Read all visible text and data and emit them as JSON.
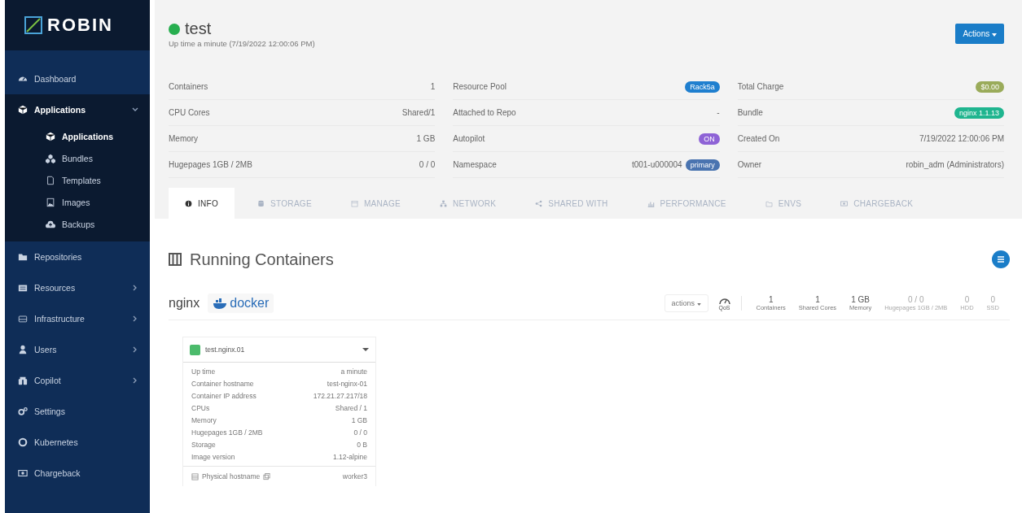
{
  "sidebar": {
    "logo": "ROBIN",
    "items": [
      {
        "label": "Dashboard",
        "selected": false
      },
      {
        "label": "Applications",
        "selected": true,
        "expanded": true,
        "children": [
          {
            "label": "Applications",
            "selected": true
          },
          {
            "label": "Bundles",
            "selected": false
          },
          {
            "label": "Templates",
            "selected": false
          },
          {
            "label": "Images",
            "selected": false
          },
          {
            "label": "Backups",
            "selected": false
          }
        ]
      },
      {
        "label": "Repositories",
        "selected": false
      },
      {
        "label": "Resources",
        "selected": false,
        "expanded": false
      },
      {
        "label": "Infrastructure",
        "selected": false,
        "expanded": false
      },
      {
        "label": "Users",
        "selected": false,
        "expanded": false
      },
      {
        "label": "Copilot",
        "selected": false,
        "expanded": false
      },
      {
        "label": "Settings",
        "selected": false
      },
      {
        "label": "Kubernetes",
        "selected": false
      },
      {
        "label": "Chargeback",
        "selected": false
      }
    ]
  },
  "header": {
    "title": "test",
    "running": true,
    "subtitle": "Up time a minute  (7/19/2022 12:00:06 PM)",
    "actions_button": "Actions"
  },
  "details": [
    {
      "label": "Containers",
      "value": "1",
      "kind": "text"
    },
    {
      "label": "Resource Pool",
      "value": "Rack5a",
      "kind": "badge",
      "color": "#1f7fcf"
    },
    {
      "label": "Total Charge",
      "value": "$0.00",
      "kind": "badge",
      "color": "#9aab5a"
    },
    {
      "label": "CPU Cores",
      "value": "Shared/1",
      "kind": "text"
    },
    {
      "label": "Attached to Repo",
      "value": "-",
      "kind": "text"
    },
    {
      "label": "Bundle",
      "value": "nginx 1.1.13",
      "kind": "badge",
      "color": "#1fb58f"
    },
    {
      "label": "Memory",
      "value": "1 GB",
      "kind": "text"
    },
    {
      "label": "Autopilot",
      "value": "ON",
      "kind": "badge",
      "color": "#8e63d6"
    },
    {
      "label": "Created On",
      "value": "7/19/2022 12:00:06 PM",
      "kind": "text"
    },
    {
      "label": "Hugepages 1GB / 2MB",
      "value": "0 / 0",
      "kind": "text"
    },
    {
      "label": "Namespace",
      "value": "t001-u000004",
      "kind": "text_badge",
      "badge": "primary",
      "color": "#4a74b0"
    },
    {
      "label": "Owner",
      "value": "robin_adm (Administrators)",
      "kind": "text"
    }
  ],
  "tabs": [
    {
      "label": "INFO",
      "selected": true
    },
    {
      "label": "STORAGE",
      "selected": false
    },
    {
      "label": "MANAGE",
      "selected": false
    },
    {
      "label": "NETWORK",
      "selected": false
    },
    {
      "label": "SHARED WITH",
      "selected": false
    },
    {
      "label": "PERFORMANCE",
      "selected": false
    },
    {
      "label": "ENVS",
      "selected": false
    },
    {
      "label": "CHARGEBACK",
      "selected": false
    }
  ],
  "running_containers": {
    "title": "Running Containers",
    "role": {
      "name": "nginx",
      "runtime_label": "docker",
      "actions_dropdown": "actions",
      "qos_label": "QoS",
      "stats": [
        {
          "value": "1",
          "label": "Containers",
          "disabled": false
        },
        {
          "value": "1",
          "label": "Shared Cores",
          "disabled": false
        },
        {
          "value": "1 GB",
          "label": "Memory",
          "disabled": false
        },
        {
          "value": "0 / 0",
          "label": "Hugepages 1GB / 2MB",
          "disabled": true
        },
        {
          "value": "0",
          "label": "HDD",
          "disabled": true
        },
        {
          "value": "0",
          "label": "SSD",
          "disabled": true
        }
      ]
    },
    "container": {
      "name": "test.nginx.01",
      "running": true,
      "expanded": true,
      "rows": [
        {
          "label": "Up time",
          "value": "a minute"
        },
        {
          "label": "Container hostname",
          "value": "test-nginx-01"
        },
        {
          "label": "Container IP address",
          "value": "172.21.27.217/18"
        },
        {
          "label": "CPUs",
          "value": "Shared / 1"
        },
        {
          "label": "Memory",
          "value": "1 GB"
        },
        {
          "label": "Hugepages 1GB / 2MB",
          "value": "0 / 0"
        },
        {
          "label": "Storage",
          "value": "0 B"
        },
        {
          "label": "Image version",
          "value": "1.12-alpine"
        }
      ],
      "physical_host": {
        "label": "Physical hostname",
        "value": "worker3"
      }
    }
  }
}
